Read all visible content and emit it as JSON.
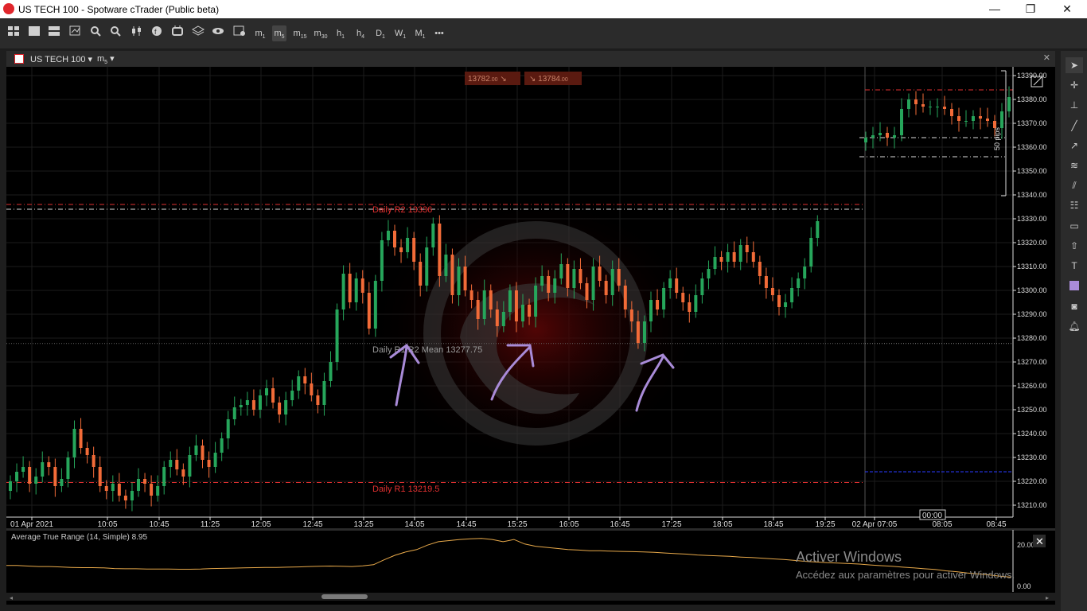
{
  "window": {
    "title": "US TECH 100 - Spotware cTrader (Public beta)",
    "min": "—",
    "max": "❐",
    "close": "✕"
  },
  "toolbar": {
    "timeframes": [
      {
        "main": "m",
        "sub": "1"
      },
      {
        "main": "m",
        "sub": "5"
      },
      {
        "main": "m",
        "sub": "15"
      },
      {
        "main": "m",
        "sub": "30"
      },
      {
        "main": "h",
        "sub": "1"
      },
      {
        "main": "h",
        "sub": "4"
      },
      {
        "main": "D",
        "sub": "1"
      },
      {
        "main": "W",
        "sub": "1"
      },
      {
        "main": "M",
        "sub": "1"
      }
    ],
    "more": "•••"
  },
  "tab": {
    "symbol": "US TECH 100 ▾",
    "timeframe": "m",
    "timeframe_sub": "5",
    "timeframe_arrow": "▾",
    "close": "✕"
  },
  "quotes": {
    "bid": "13782",
    "bid_sub": ".00",
    "ask": "13784",
    "ask_sub": ".00",
    "bid_arrow": "↘",
    "ask_arrow": "↘"
  },
  "lines": {
    "r2": "Daily R2 13336",
    "mean": "Daily R1/R2 Mean 13277.75",
    "r1": "Daily R1 13219.5"
  },
  "pips_label": "50 pips",
  "time_marker": "00:00",
  "indicator": {
    "label": "Average True Range (14, Simple) 8.95",
    "close": "✕"
  },
  "watermark": {
    "line1": "Activer Windows",
    "line2": "Accédez aux paramètres pour activer Windows."
  },
  "colors": {
    "bull": "#26a65b",
    "bear": "#f26b38",
    "bg": "#000000",
    "grid": "#1c1c1c",
    "r_line": "#e03030",
    "atr": "#e8a94a",
    "annotation": "#a98bd8"
  },
  "chart_data": {
    "type": "candlestick",
    "ylim": [
      13207,
      13392
    ],
    "y_ticks": [
      "13390.00",
      "13380.00",
      "13370.00",
      "13360.00",
      "13350.00",
      "13340.00",
      "13330.00",
      "13320.00",
      "13310.00",
      "13300.00",
      "13290.00",
      "13280.00",
      "13270.00",
      "13260.00",
      "13250.00",
      "13240.00",
      "13230.00",
      "13220.00",
      "13210.00"
    ],
    "x_labels": [
      "01 Apr 2021",
      "10:05",
      "10:45",
      "11:25",
      "12:05",
      "12:45",
      "13:25",
      "14:05",
      "14:45",
      "15:25",
      "16:05",
      "16:45",
      "17:25",
      "18:05",
      "18:45",
      "19:25",
      "02 Apr 07:05",
      "08:05",
      "08:45"
    ],
    "levels": [
      {
        "name": "Daily R2",
        "value": 13336
      },
      {
        "name": "Daily R1/R2 Mean",
        "value": 13277.75
      },
      {
        "name": "Daily R1",
        "value": 13219.5
      }
    ],
    "candles_day1": [
      13220,
      13224,
      13226,
      13219,
      13222,
      13228,
      13226,
      13218,
      13221,
      13230,
      13242,
      13234,
      13231,
      13226,
      13218,
      13216,
      13219,
      13214,
      13212,
      13216,
      13221,
      13219,
      13214,
      13218,
      13226,
      13229,
      13225,
      13222,
      13231,
      13235,
      13229,
      13226,
      13232,
      13238,
      13246,
      13251,
      13252,
      13254,
      13250,
      13256,
      13259,
      13253,
      13248,
      13254,
      13258,
      13264,
      13261,
      13256,
      13252,
      13262,
      13270,
      13292,
      13307,
      13295,
      13305,
      13299,
      13284,
      13304,
      13321,
      13325,
      13318,
      13316,
      13322,
      13312,
      13302,
      13318,
      13328,
      13306,
      13315,
      13298,
      13310,
      13300,
      13296,
      13288,
      13300,
      13292,
      13285,
      13291,
      13300,
      13287,
      13294,
      13289,
      13302,
      13306,
      13299,
      13305,
      13311,
      13301,
      13309,
      13303,
      13296,
      13310,
      13304,
      13298,
      13309,
      13302,
      13292,
      13287,
      13278,
      13287,
      13296,
      13292,
      13301,
      13305,
      13299,
      13295,
      13291,
      13298,
      13305,
      13309,
      13314,
      13312,
      13316,
      13312,
      13319,
      13316,
      13312,
      13306,
      13301,
      13298,
      13293,
      13295,
      13301,
      13305,
      13310,
      13322,
      13329
    ],
    "candles_day2": [
      13364,
      13365,
      13366,
      13364,
      13365,
      13376,
      13380,
      13378,
      13377,
      13377,
      13377,
      13376,
      13373,
      13371,
      13371,
      13373,
      13372,
      13371,
      13368,
      13375,
      13381
    ]
  }
}
